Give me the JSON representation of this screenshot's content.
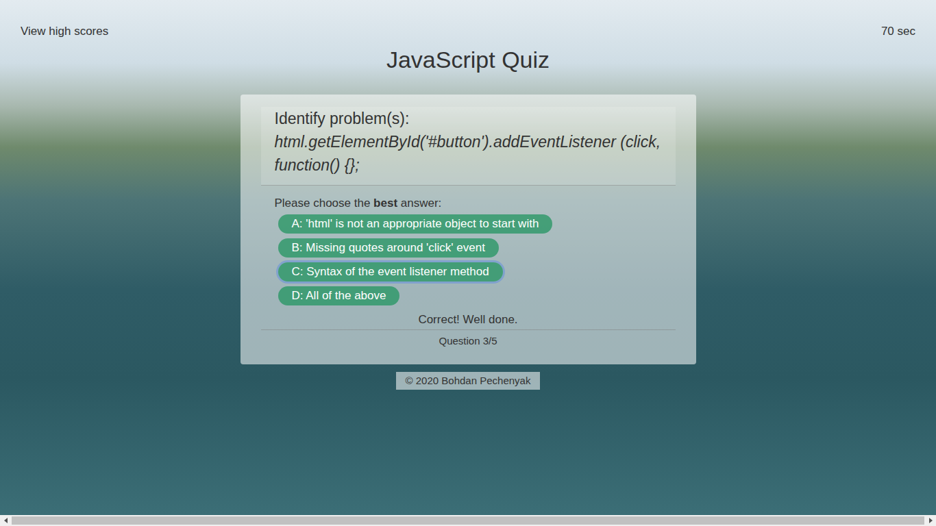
{
  "header": {
    "link": "View high scores",
    "timer": "70 sec"
  },
  "title": "JavaScript Quiz",
  "question": {
    "title": "Identify problem(s):",
    "code": "html.getElementById('#button').addEventListener (click, function() {};"
  },
  "prompt": {
    "before": "Please choose the ",
    "emphasis": "best",
    "after": " answer:"
  },
  "options": [
    {
      "label": "A: 'html' is not an appropriate object to start with",
      "selected": false
    },
    {
      "label": "B: Missing quotes around 'click' event",
      "selected": false
    },
    {
      "label": "C: Syntax of the event listener method",
      "selected": true
    },
    {
      "label": "D: All of the above",
      "selected": false
    }
  ],
  "feedback": "Correct! Well done.",
  "progress": "Question 3/5",
  "footer": "© 2020 Bohdan Pechenyak"
}
